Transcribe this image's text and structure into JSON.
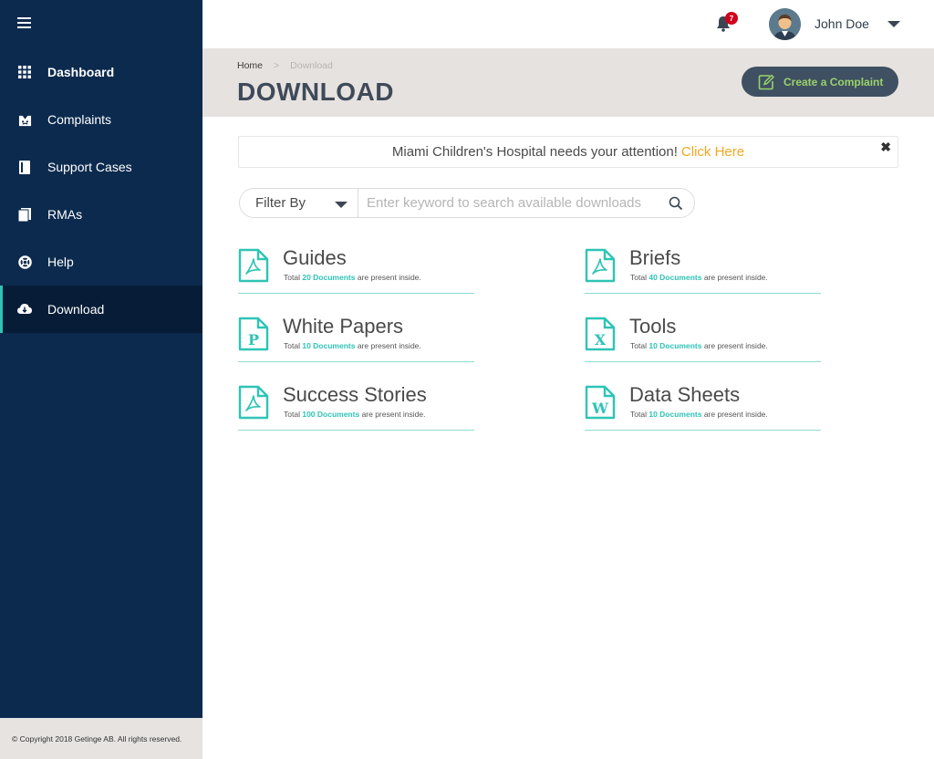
{
  "sidebar": {
    "items": [
      {
        "label": "Dashboard",
        "icon": "grid-icon"
      },
      {
        "label": "Complaints",
        "icon": "complaint-icon"
      },
      {
        "label": "Support Cases",
        "icon": "support-case-icon"
      },
      {
        "label": "RMAs",
        "icon": "rma-icon"
      },
      {
        "label": "Help",
        "icon": "lifebuoy-icon"
      },
      {
        "label": "Download",
        "icon": "cloud-download-icon"
      }
    ],
    "footer": "© Copyright 2018 Getinge AB. All rights reserved."
  },
  "topbar": {
    "notification_count": "7",
    "user_name": "John Doe"
  },
  "header": {
    "breadcrumb": {
      "home": "Home",
      "separator": ">",
      "current": "Download"
    },
    "title": "DOWNLOAD",
    "create_button": "Create a Complaint"
  },
  "alert": {
    "message": "Miami Children's Hospital needs your attention!",
    "link": "Click Here",
    "close": "✖"
  },
  "search": {
    "filter_label": "Filter By",
    "placeholder": "Enter keyword to search available downloads"
  },
  "downloads": [
    {
      "title": "Guides",
      "prefix": "Total",
      "count": "20 Documents",
      "suffix": "are present inside.",
      "icon_letter": ""
    },
    {
      "title": "Briefs",
      "prefix": "Total",
      "count": "40 Documents",
      "suffix": "are present inside.",
      "icon_letter": ""
    },
    {
      "title": "White Papers",
      "prefix": "Total",
      "count": "10 Documents",
      "suffix": "are present inside.",
      "icon_letter": "P"
    },
    {
      "title": "Tools",
      "prefix": "Total",
      "count": "10 Documents",
      "suffix": "are present inside.",
      "icon_letter": "X"
    },
    {
      "title": "Success Stories",
      "prefix": "Total",
      "count": "100 Documents",
      "suffix": "are present inside.",
      "icon_letter": ""
    },
    {
      "title": "Data Sheets",
      "prefix": "Total",
      "count": "10 Documents",
      "suffix": "are present inside.",
      "icon_letter": "W"
    }
  ],
  "colors": {
    "sidebar_bg": "#0c2a4e",
    "accent": "#2ec4b6",
    "link_orange": "#f5a623",
    "button_text": "#9ad26a"
  }
}
